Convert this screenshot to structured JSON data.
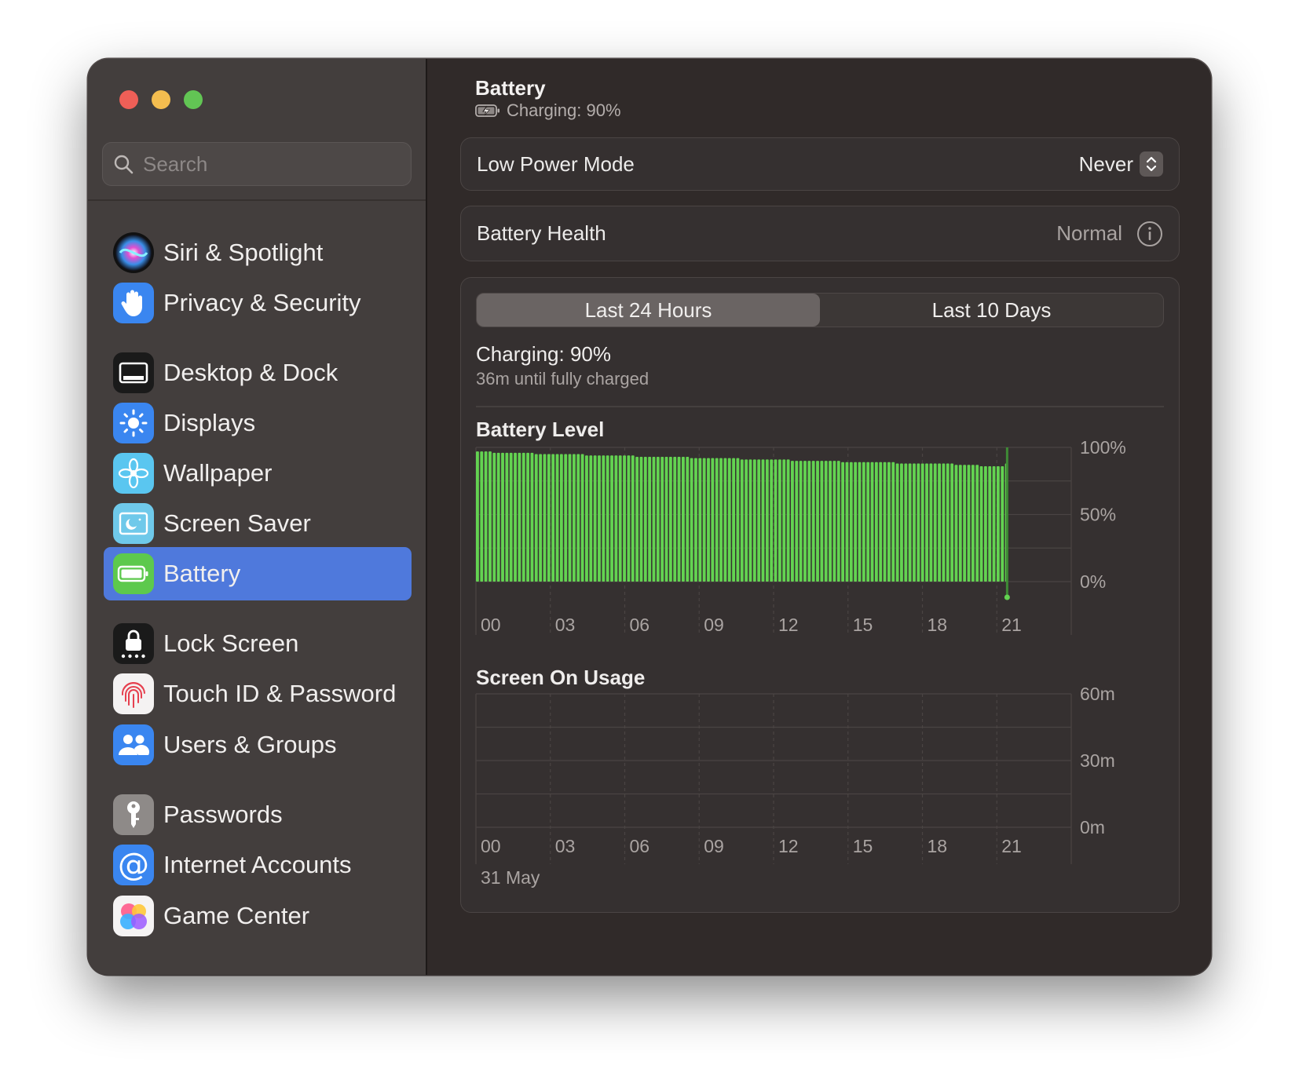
{
  "search": {
    "placeholder": "Search"
  },
  "sidebar": {
    "items": [
      {
        "label": "Siri & Spotlight",
        "icon": "siri-icon",
        "active": false
      },
      {
        "label": "Privacy & Security",
        "icon": "hand-icon",
        "active": false
      },
      {
        "label": "Desktop & Dock",
        "icon": "dock-icon",
        "active": false
      },
      {
        "label": "Displays",
        "icon": "sun-icon",
        "active": false
      },
      {
        "label": "Wallpaper",
        "icon": "flower-icon",
        "active": false
      },
      {
        "label": "Screen Saver",
        "icon": "screen-saver-icon",
        "active": false
      },
      {
        "label": "Battery",
        "icon": "battery-icon",
        "active": true
      },
      {
        "label": "Lock Screen",
        "icon": "lock-icon",
        "active": false
      },
      {
        "label": "Touch ID & Password",
        "icon": "fingerprint-icon",
        "active": false
      },
      {
        "label": "Users & Groups",
        "icon": "users-icon",
        "active": false
      },
      {
        "label": "Passwords",
        "icon": "key-icon",
        "active": false
      },
      {
        "label": "Internet Accounts",
        "icon": "at-icon",
        "active": false
      },
      {
        "label": "Game Center",
        "icon": "game-center-icon",
        "active": false
      }
    ]
  },
  "header": {
    "title": "Battery",
    "subtitle": "Charging: 90%"
  },
  "low_power": {
    "label": "Low Power Mode",
    "value": "Never"
  },
  "health": {
    "label": "Battery Health",
    "value": "Normal"
  },
  "tabs": [
    {
      "label": "Last 24 Hours",
      "active": true
    },
    {
      "label": "Last 10 Days",
      "active": false
    }
  ],
  "status": {
    "title": "Charging: 90%",
    "subtitle": "36m until fully charged"
  },
  "colors": {
    "accent": "#4f79dc",
    "bar": "#63d351",
    "background": "#302a29",
    "sidebar": "#433e3d"
  },
  "chart_data": [
    {
      "type": "bar",
      "title": "Battery Level",
      "x_ticks": [
        "00",
        "03",
        "06",
        "09",
        "12",
        "15",
        "18",
        "21"
      ],
      "y_ticks": [
        "100%",
        "50%",
        "0%"
      ],
      "ylim": [
        0,
        100
      ],
      "x_range_hours": [
        0,
        24
      ],
      "bar_start_hour": 0,
      "bar_end_hour": 21.5,
      "values": [
        97,
        97,
        97,
        97,
        96,
        96,
        96,
        96,
        96,
        96,
        96,
        96,
        96,
        96,
        95,
        95,
        95,
        95,
        95,
        95,
        95,
        95,
        95,
        95,
        95,
        95,
        94,
        94,
        94,
        94,
        94,
        94,
        94,
        94,
        94,
        94,
        94,
        94,
        93,
        93,
        93,
        93,
        93,
        93,
        93,
        93,
        93,
        93,
        93,
        93,
        93,
        92,
        92,
        92,
        92,
        92,
        92,
        92,
        92,
        92,
        92,
        92,
        92,
        91,
        91,
        91,
        91,
        91,
        91,
        91,
        91,
        91,
        91,
        91,
        91,
        90,
        90,
        90,
        90,
        90,
        90,
        90,
        90,
        90,
        90,
        90,
        90,
        89,
        89,
        89,
        89,
        89,
        89,
        89,
        89,
        89,
        89,
        89,
        89,
        89,
        88,
        88,
        88,
        88,
        88,
        88,
        88,
        88,
        88,
        88,
        88,
        88,
        88,
        88,
        87,
        87,
        87,
        87,
        87,
        87,
        86,
        86,
        86,
        86,
        86,
        86,
        88
      ]
    },
    {
      "type": "bar",
      "title": "Screen On Usage",
      "x_ticks": [
        "00",
        "03",
        "06",
        "09",
        "12",
        "15",
        "18",
        "21"
      ],
      "y_ticks": [
        "60m",
        "30m",
        "0m"
      ],
      "ylim": [
        0,
        60
      ],
      "date_label": "31 May",
      "values": []
    }
  ]
}
